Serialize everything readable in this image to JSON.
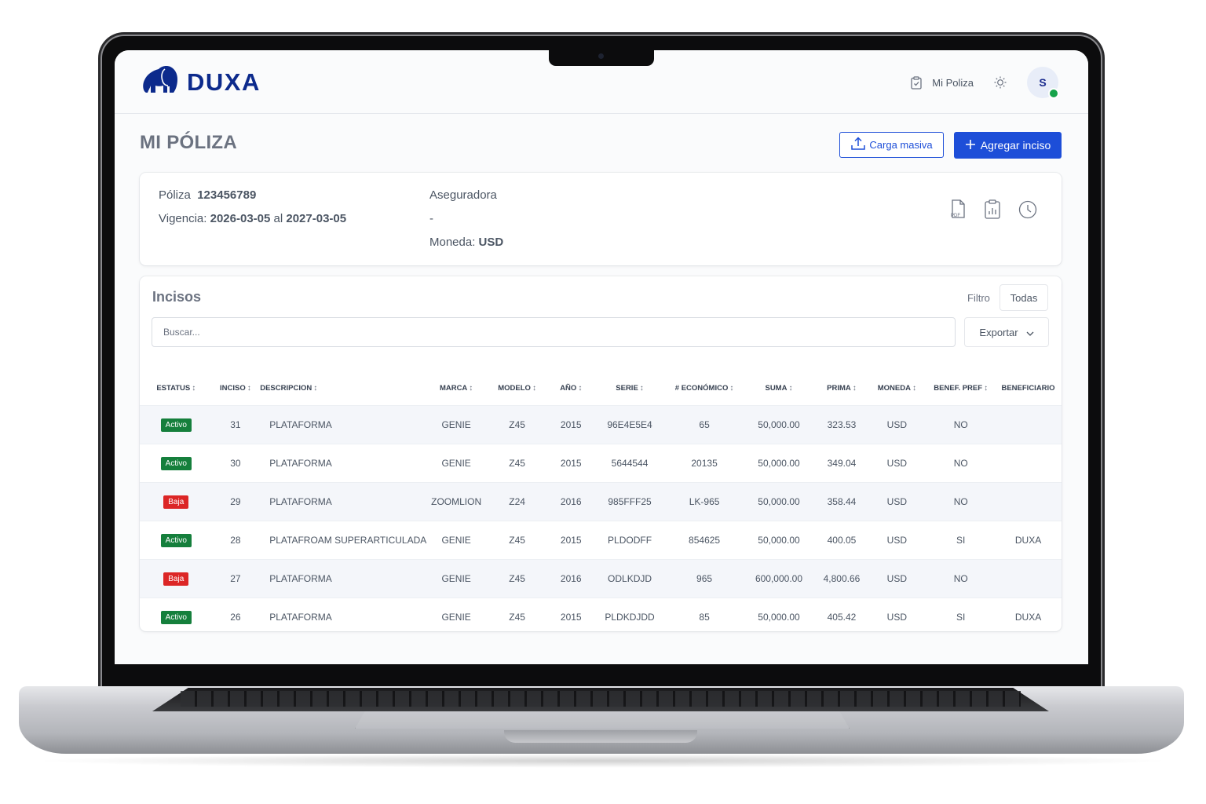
{
  "brand": {
    "name": "DUXA",
    "color": "#0c2a8c"
  },
  "header": {
    "nav_link": "Mi Poliza",
    "avatar_initial": "S"
  },
  "page": {
    "title": "MI PÓLIZA",
    "bulk_upload_label": "Carga masiva",
    "add_item_label": "Agregar inciso"
  },
  "policy": {
    "poliza_label": "Póliza",
    "poliza_number": "123456789",
    "vigencia_label": "Vigencia:",
    "vigencia_start": "2026-03-05",
    "vigencia_sep": "al",
    "vigencia_end": "2027-03-05",
    "aseguradora_label": "Aseguradora",
    "aseguradora_value": "-",
    "moneda_label": "Moneda:",
    "moneda_value": "USD",
    "icons": [
      "pdf-file-icon",
      "report-clipboard-icon",
      "history-clock-icon"
    ]
  },
  "incisos": {
    "title": "Incisos",
    "filter_label": "Filtro",
    "filter_value": "Todas",
    "search_placeholder": "Buscar...",
    "export_label": "Exportar",
    "columns": [
      "ESTATUS",
      "INCISO",
      "DESCRIPCION",
      "MARCA",
      "MODELO",
      "AÑO",
      "SERIE",
      "# ECONÓMICO",
      "SUMA",
      "PRIMA",
      "MONEDA",
      "BENEF. PREF",
      "BENEFICIARIO"
    ],
    "rows": [
      {
        "status": "Activo",
        "inciso": "31",
        "descripcion": "PLATAFORMA",
        "marca": "GENIE",
        "modelo": "Z45",
        "anio": "2015",
        "serie": "96E4E5E4",
        "economico": "65",
        "suma": "50,000.00",
        "prima": "323.53",
        "moneda": "USD",
        "benef_pref": "NO",
        "beneficiario": ""
      },
      {
        "status": "Activo",
        "inciso": "30",
        "descripcion": "PLATAFORMA",
        "marca": "GENIE",
        "modelo": "Z45",
        "anio": "2015",
        "serie": "5644544",
        "economico": "20135",
        "suma": "50,000.00",
        "prima": "349.04",
        "moneda": "USD",
        "benef_pref": "NO",
        "beneficiario": ""
      },
      {
        "status": "Baja",
        "inciso": "29",
        "descripcion": "PLATAFORMA",
        "marca": "ZOOMLION",
        "modelo": "Z24",
        "anio": "2016",
        "serie": "985FFF25",
        "economico": "LK-965",
        "suma": "50,000.00",
        "prima": "358.44",
        "moneda": "USD",
        "benef_pref": "NO",
        "beneficiario": ""
      },
      {
        "status": "Activo",
        "inciso": "28",
        "descripcion": "PLATAFROAM SUPERARTICULADA",
        "marca": "GENIE",
        "modelo": "Z45",
        "anio": "2015",
        "serie": "PLDODFF",
        "economico": "854625",
        "suma": "50,000.00",
        "prima": "400.05",
        "moneda": "USD",
        "benef_pref": "SI",
        "beneficiario": "DUXA"
      },
      {
        "status": "Baja",
        "inciso": "27",
        "descripcion": "PLATAFORMA",
        "marca": "GENIE",
        "modelo": "Z45",
        "anio": "2016",
        "serie": "ODLKDJD",
        "economico": "965",
        "suma": "600,000.00",
        "prima": "4,800.66",
        "moneda": "USD",
        "benef_pref": "NO",
        "beneficiario": ""
      },
      {
        "status": "Activo",
        "inciso": "26",
        "descripcion": "PLATAFORMA",
        "marca": "GENIE",
        "modelo": "Z45",
        "anio": "2015",
        "serie": "PLDKDJDD",
        "economico": "85",
        "suma": "50,000.00",
        "prima": "405.42",
        "moneda": "USD",
        "benef_pref": "SI",
        "beneficiario": "DUXA"
      }
    ]
  },
  "colors": {
    "primary": "#1d4ed8",
    "active": "#157f3c",
    "baja": "#dc2626",
    "online": "#16a34a"
  }
}
